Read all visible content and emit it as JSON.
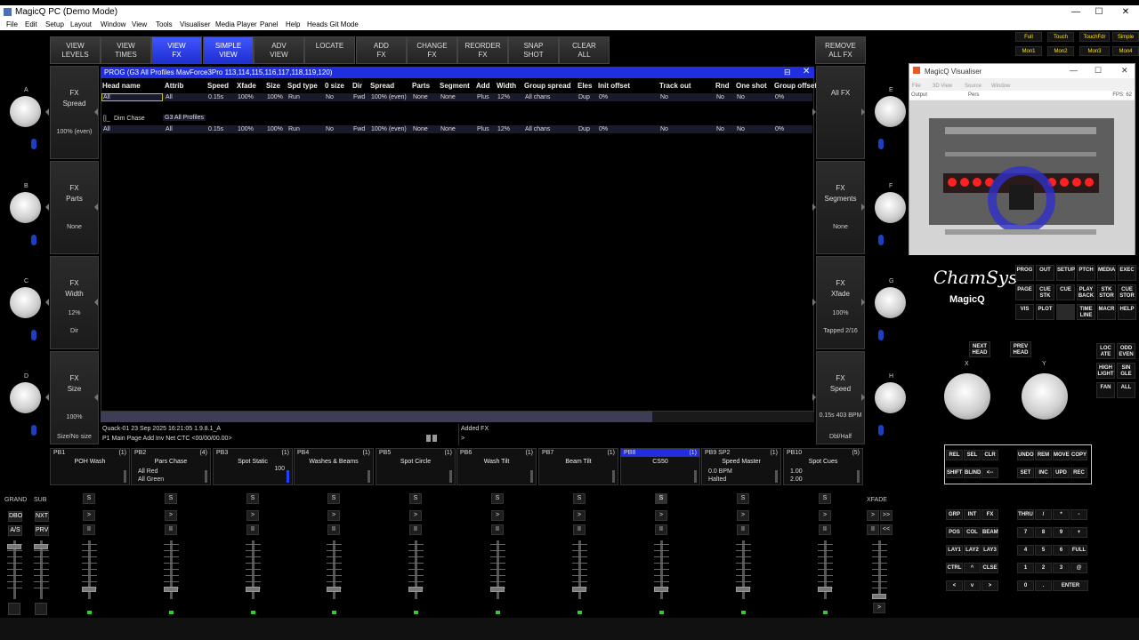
{
  "window": {
    "title": "MagicQ PC (Demo Mode)",
    "min": "—",
    "max": "☐",
    "close": "✕"
  },
  "menu": [
    "File",
    "Edit",
    "Setup",
    "Layout",
    "Window",
    "View",
    "Tools",
    "Visualiser",
    "Media Player",
    "Panel",
    "Help",
    "Heads Git Mode"
  ],
  "topkeys": [
    {
      "l1": "VIEW",
      "l2": "LEVELS"
    },
    {
      "l1": "VIEW",
      "l2": "TIMES"
    },
    {
      "l1": "VIEW",
      "l2": "FX"
    },
    {
      "l1": "SIMPLE",
      "l2": "VIEW"
    },
    {
      "l1": "ADV",
      "l2": "VIEW"
    },
    {
      "l1": "LOCATE",
      "l2": ""
    },
    {
      "l1": "ADD",
      "l2": "FX"
    },
    {
      "l1": "CHANGE",
      "l2": "FX"
    },
    {
      "l1": "REORDER",
      "l2": "FX"
    },
    {
      "l1": "SNAP",
      "l2": "SHOT"
    },
    {
      "l1": "CLEAR",
      "l2": "ALL"
    },
    {
      "l1": "REMOVE",
      "l2": "ALL FX"
    }
  ],
  "left_soft": [
    {
      "l1": "FX",
      "l2": "Spread",
      "val": "100% (even)",
      "sub": ""
    },
    {
      "l1": "FX",
      "l2": "Parts",
      "val": "None",
      "sub": ""
    },
    {
      "l1": "FX",
      "l2": "Width",
      "val": "12%",
      "sub": "Dir"
    },
    {
      "l1": "FX",
      "l2": "Size",
      "val": "100%",
      "sub": "Size/No size"
    }
  ],
  "right_soft": [
    {
      "l1": "All FX",
      "l2": "",
      "val": "",
      "sub": ""
    },
    {
      "l1": "FX",
      "l2": "Segments",
      "val": "None",
      "sub": ""
    },
    {
      "l1": "FX",
      "l2": "Xfade",
      "val": "100%",
      "sub": "Tapped 2/16"
    },
    {
      "l1": "FX",
      "l2": "Speed",
      "val": "0.15s  403 BPM",
      "sub": "Dbl/Half"
    }
  ],
  "encoders_left": [
    "A",
    "B",
    "C",
    "D"
  ],
  "encoders_right": [
    "E",
    "F",
    "G",
    "H"
  ],
  "prog": {
    "title": "PROG (G3 All Profiles MavForce3Pro 113,114,115,116,117,118,119,120)"
  },
  "columns": [
    "Head name",
    "Attrib",
    "Speed",
    "Xfade",
    "Size",
    "Spd type",
    "0 size",
    "Dir",
    "Spread",
    "Parts",
    "Segment",
    "Add",
    "Width",
    "Group spread",
    "Eles",
    "Init offset",
    "Track out",
    "Rnd",
    "One shot",
    "Group offset"
  ],
  "rows": [
    {
      "cells": [
        "All",
        "All",
        "0.15s",
        "100%",
        "100%",
        "Run",
        "No",
        "Fwd",
        "100% (even)",
        "None",
        "None",
        "Plus",
        "12%",
        "All chans",
        "Dup",
        "0%",
        "No",
        "No",
        "No",
        "0%"
      ]
    },
    {
      "cells": [
        "All",
        "All",
        "0.15s",
        "100%",
        "100%",
        "Run",
        "No",
        "Fwd",
        "100% (even)",
        "None",
        "None",
        "Plus",
        "12%",
        "All chans",
        "Dup",
        "0%",
        "No",
        "No",
        "No",
        "0%"
      ]
    }
  ],
  "fx_group": {
    "name": "Dim Chase",
    "group": "G3 All Profiles"
  },
  "status": {
    "left1": "Quack-01 23 Sep 2025 16:21:05 1.9.8.1_A",
    "left2": "P1 Main Page   Add Inv Net  CTC <00/00/00.00>",
    "right1": "Added FX",
    "right2": ">"
  },
  "playbacks": [
    {
      "num": "PB1",
      "cnt": "(1)",
      "name": "POH Wash",
      "l1": "",
      "l2": ""
    },
    {
      "num": "PB2",
      "cnt": "(4)",
      "name": "Pars Chase",
      "l1": "All Red",
      "l2": "All Green"
    },
    {
      "num": "PB3",
      "cnt": "(1)",
      "name": "Spot Static",
      "l1": "",
      "l2": "100"
    },
    {
      "num": "PB4",
      "cnt": "(1)",
      "name": "Washes & Beams",
      "l1": "",
      "l2": ""
    },
    {
      "num": "PB5",
      "cnt": "(1)",
      "name": "Spot Circle",
      "l1": "",
      "l2": ""
    },
    {
      "num": "PB6",
      "cnt": "(1)",
      "name": "Wash Tilt",
      "l1": "",
      "l2": ""
    },
    {
      "num": "PB7",
      "cnt": "(1)",
      "name": "Beam Tilt",
      "l1": "",
      "l2": ""
    },
    {
      "num": "PB8",
      "cnt": "(1)",
      "name": "CS50",
      "l1": "",
      "l2": ""
    },
    {
      "num": "PB9 SP2",
      "cnt": "(1)",
      "name": "Speed Master",
      "l1": "0.0 BPM",
      "l2": "Halted"
    },
    {
      "num": "PB10",
      "cnt": "(5)",
      "name": "Spot Cues",
      "l1": "1.00",
      "l2": "2.00"
    }
  ],
  "grand": {
    "grand": "GRAND",
    "sub": "SUB",
    "dbo": "DBO",
    "nxt": "NXT",
    "as": "A/S",
    "prv": "PRV",
    "xfade": "XFADE"
  },
  "fader_btns": {
    "s": "S",
    "go": ">",
    "pause": "II"
  },
  "visualiser": {
    "title": "MagicQ Visualiser",
    "menu": [
      "File",
      "3D View",
      "Source",
      "Window"
    ],
    "output": "Output",
    "view": "Pers",
    "fps": "FPS: 62"
  },
  "brand": {
    "name": "ChamSys",
    "sub": "MagicQ"
  },
  "view_keys": [
    [
      "Full",
      "Touch",
      "TouchFdr",
      "Simple"
    ],
    [
      "Mon1",
      "Mon2",
      "Mon3",
      "Mon4"
    ]
  ],
  "window_keys": [
    [
      "PROG",
      "OUT",
      "SETUP",
      "PTCH",
      "MEDIA",
      "EXEC"
    ],
    [
      "PAGE",
      "CUE STK",
      "CUE",
      "PLAY BACK",
      "STK STOR",
      "CUE STOR"
    ],
    [
      "VIS",
      "PLOT",
      "",
      "TIME LINE",
      "MACR",
      "HELP"
    ]
  ],
  "head_keys": {
    "next": "NEXT HEAD",
    "prev": "PREV HEAD",
    "x": "X",
    "y": "Y"
  },
  "sel_keys": [
    [
      "LOC ATE",
      "ODD EVEN"
    ],
    [
      "HIGH LIGHT",
      "SIN GLE"
    ],
    [
      "FAN",
      "ALL"
    ]
  ],
  "prog_keys": [
    [
      "REL",
      "SEL",
      "CLR",
      "",
      "UNDO",
      "REM",
      "MOVE",
      "COPY"
    ],
    [
      "SHIFT",
      "BLIND",
      "<--",
      "",
      "SET",
      "INC",
      "UPD",
      "REC"
    ]
  ],
  "keypad": [
    [
      "GRP",
      "INT",
      "FX",
      "",
      "THRU",
      "/",
      "*",
      "-"
    ],
    [
      "POS",
      "COL",
      "BEAM",
      "",
      "7",
      "8",
      "9",
      "+"
    ],
    [
      "LAY1",
      "LAY2",
      "LAY3",
      "",
      "4",
      "5",
      "6",
      "FULL"
    ],
    [
      "CTRL",
      "^",
      "CLSE",
      "",
      "1",
      "2",
      "3",
      "@"
    ],
    [
      "<",
      "v",
      ">",
      "",
      "0",
      ".",
      "ENTER",
      ""
    ]
  ]
}
